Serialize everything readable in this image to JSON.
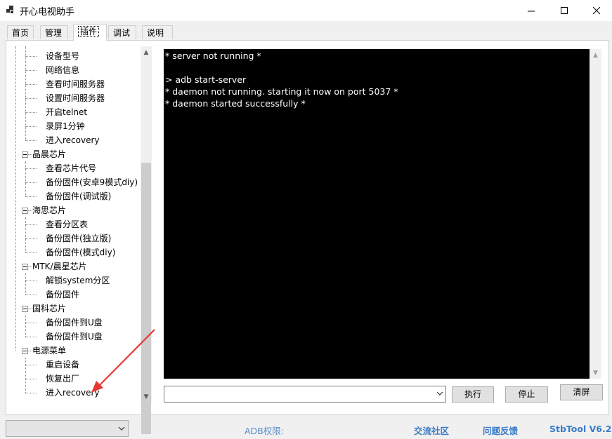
{
  "window": {
    "title": "开心电视助手"
  },
  "tabs": [
    {
      "label": "首页",
      "active": false
    },
    {
      "label": "管理",
      "active": false
    },
    {
      "label": "插件",
      "active": true
    },
    {
      "label": "调试",
      "active": false
    },
    {
      "label": "说明",
      "active": false
    }
  ],
  "tree": {
    "nodes": [
      {
        "label": "设备型号",
        "level": 1
      },
      {
        "label": "网络信息",
        "level": 1
      },
      {
        "label": "查看时间服务器",
        "level": 1
      },
      {
        "label": "设置时间服务器",
        "level": 1
      },
      {
        "label": "开启telnet",
        "level": 1
      },
      {
        "label": "录屏1分钟",
        "level": 1
      },
      {
        "label": "进入recovery",
        "level": 1
      },
      {
        "label": "晶晨芯片",
        "level": 0
      },
      {
        "label": "查看芯片代号",
        "level": 1
      },
      {
        "label": "备份固件(安卓9模式diy)",
        "level": 1
      },
      {
        "label": "备份固件(调试版)",
        "level": 1
      },
      {
        "label": "海思芯片",
        "level": 0
      },
      {
        "label": "查看分区表",
        "level": 1
      },
      {
        "label": "备份固件(独立版)",
        "level": 1
      },
      {
        "label": "备份固件(模式diy)",
        "level": 1
      },
      {
        "label": "MTK/晨星芯片",
        "level": 0
      },
      {
        "label": "解锁system分区",
        "level": 1
      },
      {
        "label": "备份固件",
        "level": 1
      },
      {
        "label": "国科芯片",
        "level": 0
      },
      {
        "label": "备份固件到U盘",
        "level": 1
      },
      {
        "label": "备份固件到U盘",
        "level": 1
      },
      {
        "label": "电源菜单",
        "level": 0
      },
      {
        "label": "重启设备",
        "level": 1
      },
      {
        "label": "恢复出厂",
        "level": 1
      },
      {
        "label": "进入recovery",
        "level": 1
      }
    ]
  },
  "console": {
    "lines": [
      "* server not running *",
      "",
      "> adb start-server",
      "* daemon not running. starting it now on port 5037 *",
      "* daemon started successfully *"
    ]
  },
  "command": {
    "input_value": "",
    "execute_label": "执行",
    "stop_label": "停止",
    "clear_label": "清屏"
  },
  "statusbar": {
    "device_select_value": "",
    "adb_permission_label": "ADB权限:",
    "community_link": "交流社区",
    "feedback_link": "问题反馈",
    "version": "StbTool V6.2"
  },
  "colors": {
    "annotation_arrow": "#e53935",
    "console_bg": "#000000",
    "link": "#3a7bc8"
  }
}
